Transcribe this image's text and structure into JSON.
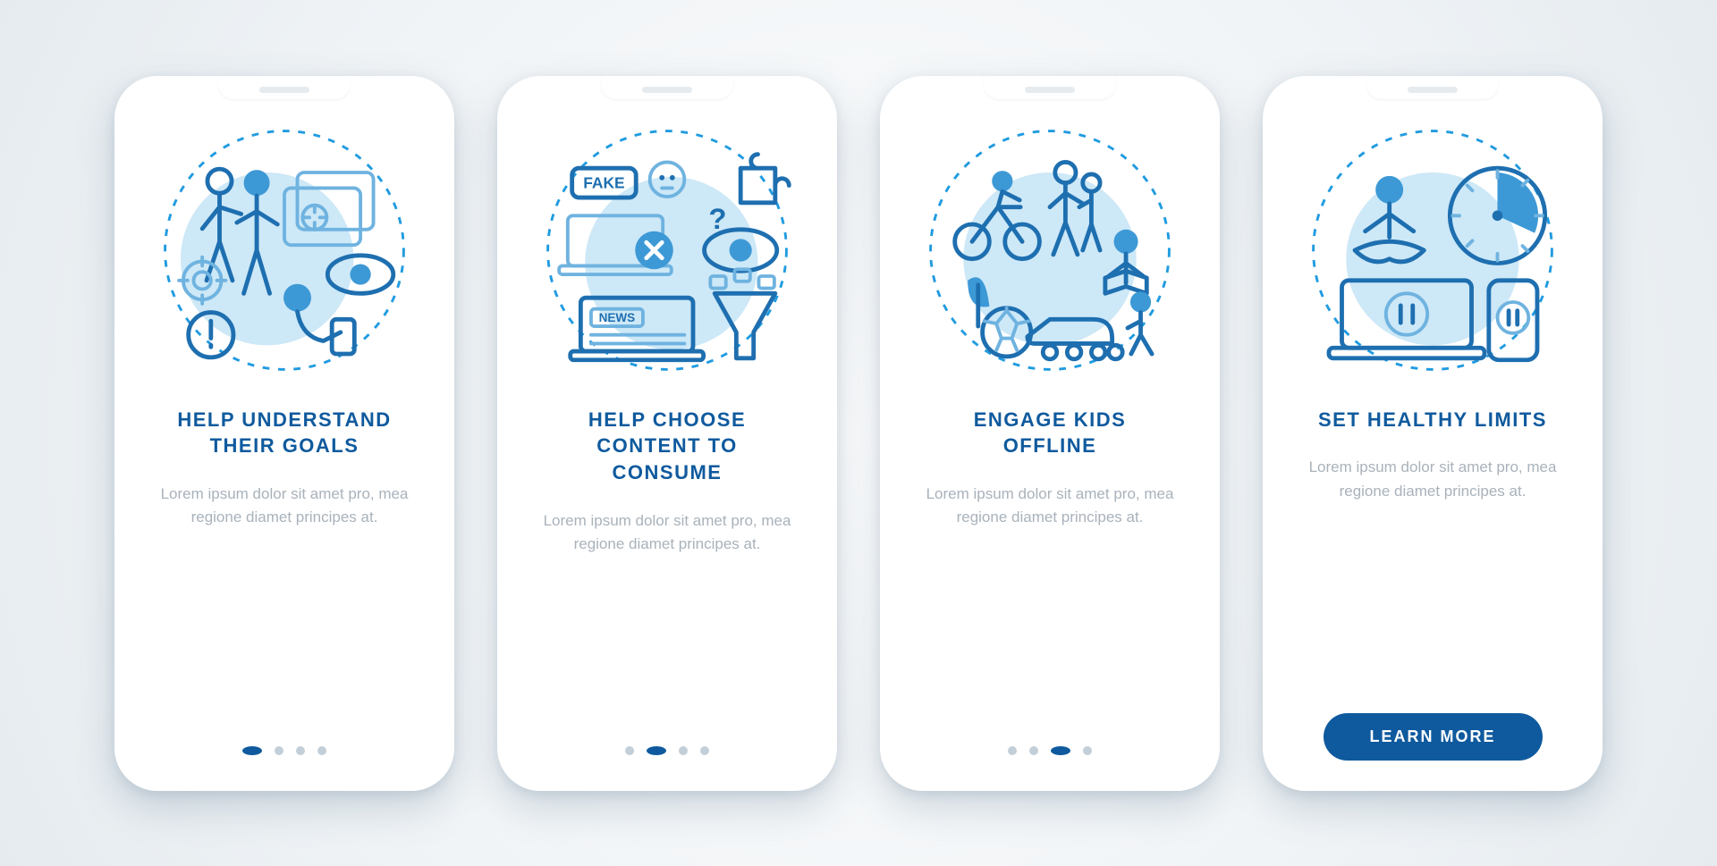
{
  "screens": [
    {
      "illustration": "goals-illustration",
      "title": "HELP UNDERSTAND THEIR GOALS",
      "body": "Lorem ipsum dolor sit amet pro, mea regione diamet principes at.",
      "active_dot": 0,
      "has_button": false
    },
    {
      "illustration": "content-illustration",
      "title": "HELP CHOOSE CONTENT TO CONSUME",
      "body": "Lorem ipsum dolor sit amet pro, mea regione diamet principes at.",
      "active_dot": 1,
      "has_button": false
    },
    {
      "illustration": "offline-illustration",
      "title": "ENGAGE KIDS OFFLINE",
      "body": "Lorem ipsum dolor sit amet pro, mea regione diamet principes at.",
      "active_dot": 2,
      "has_button": false
    },
    {
      "illustration": "limits-illustration",
      "title": "SET HEALTHY LIMITS",
      "body": "Lorem ipsum dolor sit amet pro, mea regione diamet principes at.",
      "active_dot": 3,
      "has_button": true
    }
  ],
  "button_label": "LEARN MORE",
  "dot_count": 4,
  "labels": {
    "fake": "FAKE",
    "news": "NEWS"
  },
  "colors": {
    "brand": "#0f5a9e",
    "accent": "#3d99d6",
    "muted": "#a9b2bb"
  }
}
